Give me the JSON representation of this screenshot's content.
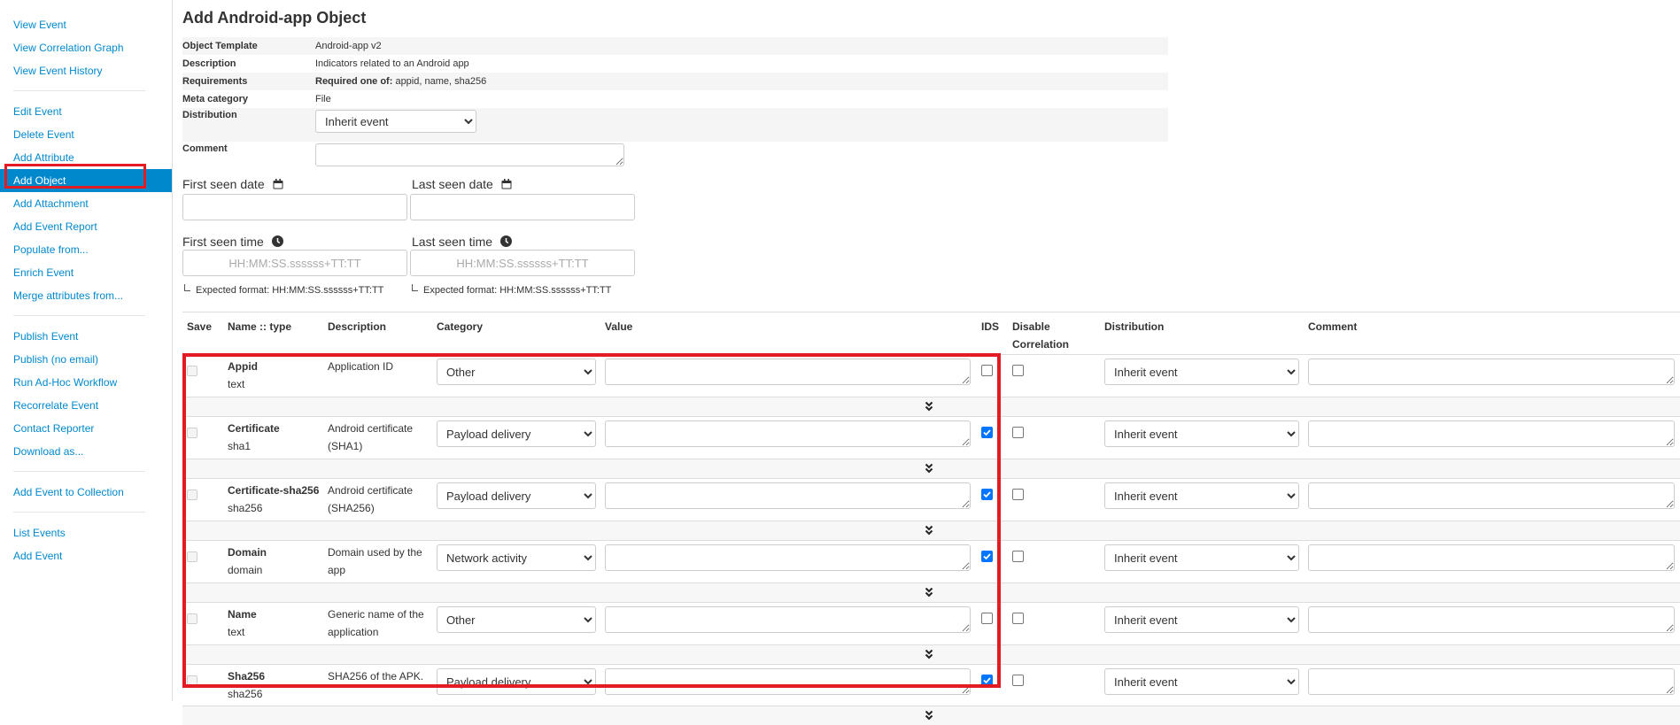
{
  "sidebar": {
    "groups": [
      [
        "View Event",
        "View Correlation Graph",
        "View Event History"
      ],
      [
        "Edit Event",
        "Delete Event",
        "Add Attribute",
        "Add Object",
        "Add Attachment",
        "Add Event Report",
        "Populate from...",
        "Enrich Event",
        "Merge attributes from..."
      ],
      [
        "Publish Event",
        "Publish (no email)",
        "Run Ad-Hoc Workflow",
        "Recorrelate Event",
        "Contact Reporter",
        "Download as..."
      ],
      [
        "Add Event to Collection"
      ],
      [
        "List Events",
        "Add Event"
      ]
    ],
    "active": "Add Object"
  },
  "page": {
    "title": "Add Android-app Object",
    "info": {
      "object_template_label": "Object Template",
      "object_template_value": "Android-app v2",
      "description_label": "Description",
      "description_value": "Indicators related to an Android app",
      "requirements_label": "Requirements",
      "requirements_prefix": "Required one of:",
      "requirements_value": " appid, name, sha256",
      "meta_category_label": "Meta category",
      "meta_category_value": "File",
      "distribution_label": "Distribution",
      "distribution_value": "Inherit event",
      "comment_label": "Comment"
    },
    "dates": {
      "first_seen_date_label": "First seen date",
      "last_seen_date_label": "Last seen date",
      "first_seen_time_label": "First seen time",
      "last_seen_time_label": "Last seen time",
      "time_placeholder": "HH:MM:SS.ssssss+TT:TT",
      "expected_format": "Expected format: HH:MM:SS.ssssss+TT:TT"
    }
  },
  "table": {
    "headers": {
      "save": "Save",
      "name_type": "Name :: type",
      "description": "Description",
      "category": "Category",
      "value": "Value",
      "ids": "IDS",
      "disable_correlation_1": "Disable",
      "disable_correlation_2": "Correlation",
      "distribution": "Distribution",
      "comment": "Comment"
    },
    "rows": [
      {
        "name": "Appid",
        "type": "text",
        "desc1": "Application ID",
        "desc2": "",
        "category": "Other",
        "ids": false,
        "distribution": "Inherit event"
      },
      {
        "name": "Certificate",
        "type": "sha1",
        "desc1": "Android certificate",
        "desc2": "(SHA1)",
        "category": "Payload delivery",
        "ids": true,
        "distribution": "Inherit event"
      },
      {
        "name": "Certificate-sha256",
        "type": "sha256",
        "desc1": "Android certificate",
        "desc2": "(SHA256)",
        "category": "Payload delivery",
        "ids": true,
        "distribution": "Inherit event"
      },
      {
        "name": "Domain",
        "type": "domain",
        "desc1": "Domain used by the",
        "desc2": "app",
        "category": "Network activity",
        "ids": true,
        "distribution": "Inherit event"
      },
      {
        "name": "Name",
        "type": "text",
        "desc1": "Generic name of the",
        "desc2": "application",
        "category": "Other",
        "ids": false,
        "distribution": "Inherit event"
      },
      {
        "name": "Sha256",
        "type": "sha256",
        "desc1": "SHA256 of the APK.",
        "desc2": "",
        "category": "Payload delivery",
        "ids": true,
        "distribution": "Inherit event"
      }
    ]
  },
  "colors": {
    "link": "#0088cc",
    "active_bg": "#0088cc",
    "highlight": "#e31b23",
    "checkbox_checked": "#0075ff"
  },
  "icons": {
    "date": "calendar-icon",
    "time": "clock-icon",
    "expand": "chevron-double-down-icon"
  }
}
